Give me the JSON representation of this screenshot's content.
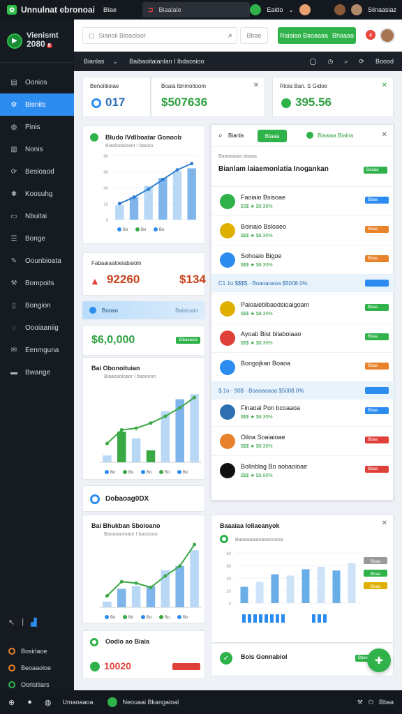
{
  "topbar": {
    "app_title": "Unnulnat ebronoai",
    "sub_label": "Biae",
    "tab_label": "Biaalale",
    "user_label": "Eaido",
    "user2_label": "Siinaasiaz"
  },
  "sidebar": {
    "logo_line1": "Vienismt",
    "logo_line2": "2080",
    "logo_badge": "8",
    "items": [
      {
        "label": "Oonios",
        "icon": "document-icon"
      },
      {
        "label": "Bisnits",
        "icon": "settings-icon"
      },
      {
        "label": "Pinis",
        "icon": "globe-icon"
      },
      {
        "label": "Nonis",
        "icon": "chart-icon"
      },
      {
        "label": "Besioaod",
        "icon": "refresh-icon"
      },
      {
        "label": "Koosuhg",
        "icon": "gear-icon"
      },
      {
        "label": "Nbuitai",
        "icon": "inbox-icon"
      },
      {
        "label": "Bonge",
        "icon": "list-icon"
      },
      {
        "label": "Oounbioata",
        "icon": "pen-icon"
      },
      {
        "label": "Bompoits",
        "icon": "tools-icon"
      },
      {
        "label": "Bongion",
        "icon": "book-icon"
      },
      {
        "label": "Oooiaaniig",
        "icon": "chat-icon"
      },
      {
        "label": "Eenmguna",
        "icon": "mail-icon"
      },
      {
        "label": "Bwange",
        "icon": "card-icon"
      }
    ],
    "bottom_items": [
      {
        "label": "Bosirlaoe",
        "color": "#e8822b"
      },
      {
        "label": "Beoaaoloe",
        "color": "#e8822b"
      },
      {
        "label": "Oorisitiars",
        "color": "#2fb24a"
      }
    ]
  },
  "header": {
    "search_placeholder": "Sianoil Bibaolaor",
    "filter_label": "Bbae",
    "cta_label_1": "Raiaiao Baoaaaa",
    "cta_label_2": "Bhaaaa",
    "notif_count": "4"
  },
  "crumbbar": {
    "item1": "Bianlas",
    "item2": "Baibaoitaianlan I lbdaosioo",
    "right_label": "Boood"
  },
  "kpis": [
    {
      "label": "Benoitiioiae",
      "value": "017",
      "color": "#2d6fb0"
    },
    {
      "label": "Boaia lbnmoitoom",
      "value": "$507636",
      "color": "#2fa040"
    },
    {
      "label": "Rioia Ban. S Gidoe",
      "value": "395.56",
      "color": "#2fa040"
    }
  ],
  "chart1": {
    "title": "Bludo lVdlboatar Gonoob",
    "subtitle": "Biaoloeaioaor I baooo",
    "chart_data": {
      "type": "bar",
      "categories": [
        "Bo",
        "Bo",
        "Bo",
        "Bo",
        "Bo",
        "Bo"
      ],
      "series": [
        {
          "name": "",
          "values": [
            18,
            28,
            42,
            52,
            60,
            64
          ],
          "kind": "bar"
        },
        {
          "name": "",
          "values": [
            20,
            28,
            38,
            50,
            62,
            70
          ],
          "kind": "line"
        }
      ],
      "ylim": [
        0,
        80
      ],
      "ticks": [
        "0",
        "20",
        "40",
        "60",
        "80"
      ],
      "legend": [
        "Bo",
        "Bo",
        "Bo"
      ]
    }
  },
  "revenue": {
    "label": "Fabaaiaaloeiabaioln",
    "value1": "92260",
    "value2": "$134"
  },
  "banner": {
    "label": "Booao",
    "right": "Baiaioaio"
  },
  "bigvalue": {
    "value": "$6,0,000",
    "pill": "Bibaoaoia"
  },
  "chart2": {
    "title": "Bai Obonoituian",
    "subtitle": "Biaaoaoioaor I baooooo",
    "chart_data": {
      "type": "bar",
      "categories": [
        "Bo",
        "Bo",
        "Bo",
        "Bo",
        "Bo",
        "Bo",
        "Bo"
      ],
      "series": [
        {
          "name": "",
          "values": [
            8,
            36,
            28,
            14,
            60,
            74,
            80
          ],
          "kind": "bar"
        },
        {
          "name": "",
          "values": [
            22,
            38,
            40,
            46,
            54,
            64,
            76
          ],
          "kind": "line"
        }
      ],
      "ylim": [
        0,
        90
      ],
      "legend": [
        "Bo",
        "Bo",
        "Bo",
        "Bo",
        "Bo"
      ]
    }
  },
  "card_small": {
    "label": "Dobaoag0DX",
    "icon_color": "#2d8cf0"
  },
  "chart3": {
    "title": "Bai Bhukban Sboioano",
    "subtitle": "Baoaoaoioaor I baooooo",
    "chart_data": {
      "type": "bar",
      "categories": [
        "Bo",
        "Bo",
        "Bo",
        "Bo",
        "Bo",
        "Bo",
        "Bo"
      ],
      "series": [
        {
          "name": "",
          "values": [
            8,
            26,
            30,
            30,
            52,
            58,
            80
          ],
          "kind": "bar"
        },
        {
          "name": "",
          "values": [
            16,
            36,
            34,
            28,
            44,
            58,
            88
          ],
          "kind": "line"
        }
      ],
      "ylim": [
        0,
        90
      ],
      "legend": [
        "Bo",
        "Bo",
        "Bo",
        "Bo",
        "Bo"
      ]
    }
  },
  "bottomcard": {
    "label": "Oodio ao Biaia",
    "value": "10020"
  },
  "rightpanel": {
    "search_label": "Bianla",
    "tab_active": "Biaaa",
    "tab2": "Biaaiaa Biaina",
    "list_header": "Baaaaaaia aaaaa",
    "section_title": "Bianlam laiaemonlatia Inogankan",
    "section_pill": "Baaaa",
    "rows": [
      {
        "name": "Faoiaio Bsisoae",
        "sub": "$3$ ★ $9.36%",
        "pill": "Bbaa",
        "pill_color": "blue",
        "icon_color": "#2fb24a"
      },
      {
        "name": "Boinaio Bsloaeo",
        "sub": "$$$ ★ $8.30%",
        "pill": "Bbaa",
        "pill_color": "orange",
        "icon_color": "#e0b000"
      },
      {
        "name": "Sohoaio Bigoe",
        "sub": "$$$ ★ $8.30%",
        "pill": "Bbaa",
        "pill_color": "orange",
        "icon_color": "#2d8cf0"
      },
      {
        "name": "Paioaieblbaodsioaigoam",
        "sub": "$$$ ★ $8.30%",
        "pill": "Bbaa",
        "pill_color": "green",
        "icon_color": "#e0b000"
      },
      {
        "name": "Ayoab Bist biiaboiaao",
        "sub": "$$$ ★ $8.30%",
        "pill": "Bbaa",
        "pill_color": "green",
        "icon_color": "#e0403a"
      },
      {
        "name": "Bongojkan Boaoa",
        "sub": "",
        "pill": "Bbaa",
        "pill_color": "orange",
        "icon_color": "#2d8cf0"
      },
      {
        "name": "Finaoai Pon bcoaaoa",
        "sub": "$$$ ★ $8.30%",
        "pill": "Bbaa",
        "pill_color": "blue",
        "icon_color": "#2d6fb0"
      },
      {
        "name": "Oiloa Soaiaioae",
        "sub": "$$$ ★ $8.30%",
        "pill": "Bbaa",
        "pill_color": "red",
        "icon_color": "#e8822b"
      },
      {
        "name": "Bollnblag Bo aobaoioae",
        "sub": "$$$ ★ $9.90%",
        "pill": "Bbaa",
        "pill_color": "red",
        "icon_color": "#111111"
      }
    ],
    "subrows": [
      {
        "text": "C1 1o $$$$ · Boaoaoaoa $5008.0%"
      },
      {
        "text": "$ 1o · 90$ · Boaoaoaoa $5008.0%"
      }
    ]
  },
  "chart4": {
    "title": "Baaaiaa Ioliaeanyok",
    "subtitle": "Baaaaaiaaoaaaooaoa",
    "chart_data": {
      "type": "bar",
      "categories": [
        "Bo",
        "Bo",
        "Bo",
        "Bo",
        "Bo",
        "Bo",
        "Bo",
        "Bo"
      ],
      "series": [
        {
          "name": "",
          "values": [
            26,
            34,
            46,
            44,
            54,
            58,
            52,
            64
          ]
        }
      ],
      "ylim": [
        0,
        80
      ],
      "ticks": [
        "0",
        "20",
        "40",
        "60",
        "80"
      ],
      "legend_pills": [
        "Bbaa",
        "Bbaa",
        "Bbaa"
      ]
    }
  },
  "bottomright": {
    "label": "Bois Gonnabiol",
    "pill": "Bbaa"
  },
  "footer": {
    "label1": "Umaoaaoa",
    "label2": "Neouaai Bkangaioal",
    "right": "Bbaa"
  }
}
